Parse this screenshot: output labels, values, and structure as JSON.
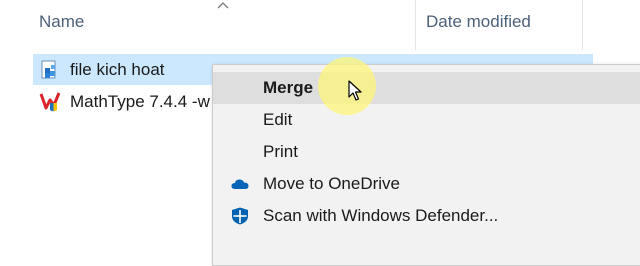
{
  "header": {
    "name_label": "Name",
    "date_label": "Date modified"
  },
  "files": [
    {
      "name": "file kich hoat",
      "icon": "registry-file-icon",
      "selected": true
    },
    {
      "name": "MathType 7.4.4 -w",
      "icon": "mathtype-app-icon",
      "selected": false
    }
  ],
  "context_menu": {
    "items": [
      {
        "label": "Merge",
        "bold": true,
        "icon": ""
      },
      {
        "label": "Edit",
        "bold": false,
        "icon": ""
      },
      {
        "label": "Print",
        "bold": false,
        "icon": ""
      },
      {
        "label": "Move to OneDrive",
        "bold": false,
        "icon": "onedrive-cloud-icon"
      },
      {
        "label": "Scan with Windows Defender...",
        "bold": false,
        "icon": "windows-defender-shield-icon"
      }
    ]
  },
  "colors": {
    "selection": "#cce8ff",
    "menu_bg": "#f2f2f2",
    "menu_hover": "#dedede",
    "onedrive_blue": "#0364b8",
    "defender_blue": "#0063b1",
    "header_text": "#4c607a"
  }
}
